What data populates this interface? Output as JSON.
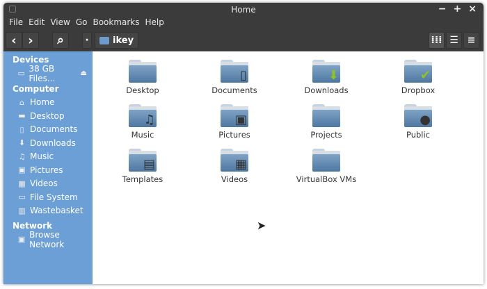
{
  "window": {
    "title": "Home",
    "controls": [
      "−",
      "+",
      "×"
    ]
  },
  "menu": [
    "File",
    "Edit",
    "View",
    "Go",
    "Bookmarks",
    "Help"
  ],
  "toolbar": {
    "back": "‹",
    "forward": "›",
    "search": "⌕",
    "path_toggle": "·",
    "location": "ikey"
  },
  "sidebar": {
    "devices_header": "Devices",
    "devices": [
      {
        "label": "38 GB Files...",
        "icon": "drive-icon"
      }
    ],
    "computer_header": "Computer",
    "computer": [
      {
        "label": "Home",
        "glyph": "⌂"
      },
      {
        "label": "Desktop",
        "glyph": "▬"
      },
      {
        "label": "Documents",
        "glyph": "▯"
      },
      {
        "label": "Downloads",
        "glyph": "⬇"
      },
      {
        "label": "Music",
        "glyph": "♫"
      },
      {
        "label": "Pictures",
        "glyph": "▣"
      },
      {
        "label": "Videos",
        "glyph": "▦"
      },
      {
        "label": "File System",
        "glyph": "▭"
      },
      {
        "label": "Wastebasket",
        "glyph": "▥"
      }
    ],
    "network_header": "Network",
    "network": [
      {
        "label": "Browse Network",
        "glyph": "▣"
      }
    ]
  },
  "items": [
    {
      "label": "Desktop",
      "emblem": ""
    },
    {
      "label": "Documents",
      "emblem": "▯"
    },
    {
      "label": "Downloads",
      "emblem": "⬇"
    },
    {
      "label": "Dropbox",
      "emblem": "✔"
    },
    {
      "label": "Music",
      "emblem": "♫"
    },
    {
      "label": "Pictures",
      "emblem": "▣"
    },
    {
      "label": "Projects",
      "emblem": ""
    },
    {
      "label": "Public",
      "emblem": "●"
    },
    {
      "label": "Templates",
      "emblem": "▤"
    },
    {
      "label": "Videos",
      "emblem": "▦"
    },
    {
      "label": "VirtualBox VMs",
      "emblem": ""
    }
  ]
}
